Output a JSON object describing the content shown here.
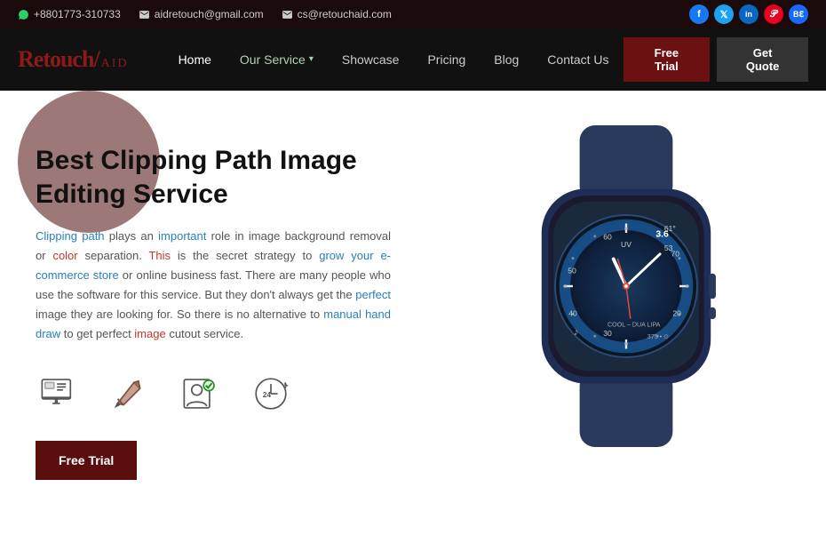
{
  "topbar": {
    "phone": "+8801773-310733",
    "email1": "aidretouch@gmail.com",
    "email2": "cs@retouchaid.com"
  },
  "social": [
    {
      "name": "facebook",
      "letter": "f",
      "class": "fb"
    },
    {
      "name": "twitter",
      "letter": "t",
      "class": "tw"
    },
    {
      "name": "linkedin",
      "letter": "in",
      "class": "li"
    },
    {
      "name": "pinterest",
      "letter": "p",
      "class": "pi"
    },
    {
      "name": "behance",
      "letter": "be",
      "class": "be"
    }
  ],
  "logo": {
    "text": "Retouch",
    "aid": "AID"
  },
  "nav": {
    "home": "Home",
    "our_service": "Our Service",
    "showcase": "Showcase",
    "pricing": "Pricing",
    "blog": "Blog",
    "contact_us": "Contact Us"
  },
  "buttons": {
    "free_trial": "Free Trial",
    "get_quote": "Get Quote"
  },
  "hero": {
    "title": "Best Clipping Path Image Editing Service",
    "body": "Clipping path plays an important role in image background removal or color separation. This is the secret strategy to grow your e-commerce store or online business fast. There are many people who use the software for this service. But they don't always get the perfect image they are looking for. So there is no alternative to manual hand draw to get perfect image cutout service.",
    "cta": "Free Trial"
  },
  "icons": [
    {
      "name": "monitor-icon",
      "label": "Monitor"
    },
    {
      "name": "pen-icon",
      "label": "Pen"
    },
    {
      "name": "person-check-icon",
      "label": "Person Check"
    },
    {
      "name": "clock-24-icon",
      "label": "24 hours"
    }
  ],
  "colors": {
    "accent_red": "#5a0e0e",
    "dark_bg": "#111111",
    "topbar_bg": "#1a0a0a"
  }
}
